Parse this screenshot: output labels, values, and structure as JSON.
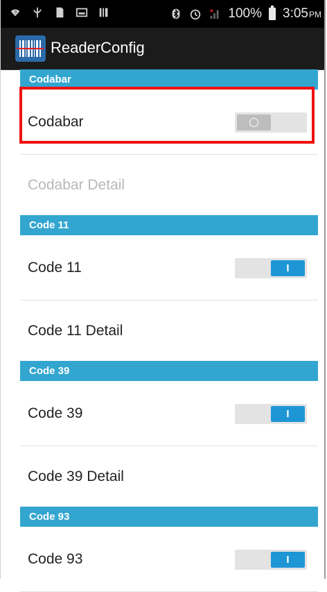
{
  "status_bar": {
    "battery": "100%",
    "time": "3:05",
    "ampm": "PM",
    "icons": [
      "wifi-icon",
      "usb-icon",
      "sdcard-icon",
      "image-icon",
      "barcode-icon",
      "bluetooth-icon",
      "alarm-icon",
      "signal-icon",
      "battery-icon"
    ]
  },
  "action_bar": {
    "title": "ReaderConfig",
    "icon": "barcode-app-icon"
  },
  "sections": [
    {
      "header": "Codabar",
      "toggle_label": "Codabar",
      "toggle_state": "off",
      "detail_label": "Codabar Detail",
      "detail_enabled": false
    },
    {
      "header": "Code 11",
      "toggle_label": "Code 11",
      "toggle_state": "on",
      "detail_label": "Code 11 Detail",
      "detail_enabled": true
    },
    {
      "header": "Code 39",
      "toggle_label": "Code 39",
      "toggle_state": "on",
      "detail_label": "Code 39 Detail",
      "detail_enabled": true
    },
    {
      "header": "Code 93",
      "toggle_label": "Code 93",
      "toggle_state": "on"
    }
  ],
  "toggle_glyphs": {
    "on": "I",
    "off": "O"
  },
  "colors": {
    "header_bg": "#33a6d0",
    "toggle_on": "#1e96d6",
    "highlight": "#ee1111"
  }
}
